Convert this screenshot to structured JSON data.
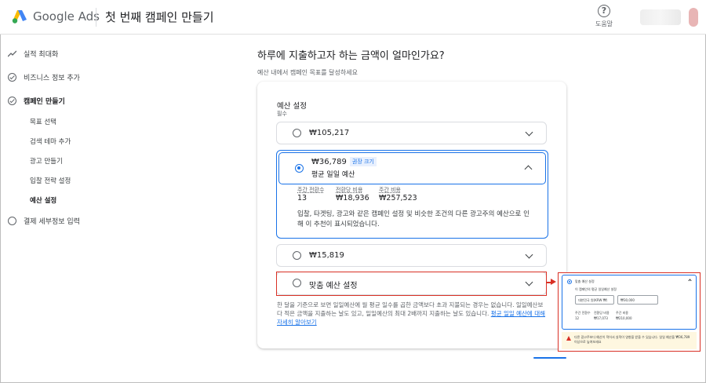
{
  "header": {
    "brand": "Google Ads",
    "page_title": "첫 번째 캠페인 만들기",
    "help_label": "도움말"
  },
  "sidebar": {
    "items": [
      {
        "label": "실적 최대화"
      },
      {
        "label": "비즈니스 정보 추가"
      },
      {
        "label": "캠페인 만들기"
      },
      {
        "label": "결제 세부정보 입력"
      }
    ],
    "sub_items": [
      {
        "label": "목표 선택"
      },
      {
        "label": "검색 테마 추가"
      },
      {
        "label": "광고 만들기"
      },
      {
        "label": "입찰 전략 설정"
      },
      {
        "label": "예산 설정"
      }
    ]
  },
  "main": {
    "title": "하루에 지출하고자 하는 금액이 얼마인가요?",
    "subtitle": "예산 내에서 캠페인 목표를 달성하세요",
    "card_title": "예산 설정",
    "required": "필수",
    "options": [
      {
        "amount": "₩105,217"
      },
      {
        "amount": "₩36,789",
        "badge": "권장 크기",
        "sub": "평균 일일 예산"
      },
      {
        "amount": "₩15,819"
      },
      {
        "amount": "맞춤 예산 설정"
      }
    ],
    "stats": [
      {
        "label": "주간 전환수",
        "value": "13"
      },
      {
        "label": "전환당 비용",
        "value": "₩18,936"
      },
      {
        "label": "주간 비용",
        "value": "₩257,523"
      }
    ],
    "description": "입찰, 타겟팅, 광고와 같은 캠페인 설정 및 비슷한 조건의 다른 광고주의 예산으로 인해 이 추천이 표시되었습니다.",
    "footnote": "한 달을 기준으로 보면 일일예산에 월 평균 일수를 곱한 금액보다 초과 지불되는 경우는 없습니다. 일일예산보다 적은 금액을 지출하는 날도 있고, 일일예산의 최대 2배까지 지출하는 날도 있습니다.",
    "footnote_link": "평균 일일 예산에 대해 자세히 알아보기"
  },
  "zoom": {
    "title": "맞춤 예산 설정",
    "prompt": "이 캠페인의 평균 일일예산 설정",
    "currency": "대한민국 원(KRW ₩)",
    "amount": "₩30,000",
    "stats": [
      {
        "label": "주간 전환수",
        "value": "12"
      },
      {
        "label": "전환당 비용",
        "value": "₩17,073"
      },
      {
        "label": "주간 비용",
        "value": "₩210,000"
      }
    ],
    "warning": "다른 광고주보다 예산이 적어서 실적이 영향을 받을 수 있습니다. 일일 예산을 ₩36,789 이상으로 높여보세요"
  },
  "colors": {
    "accent": "#1a73e8",
    "highlight": "#d93025",
    "warning_bg": "#fef7e0"
  }
}
